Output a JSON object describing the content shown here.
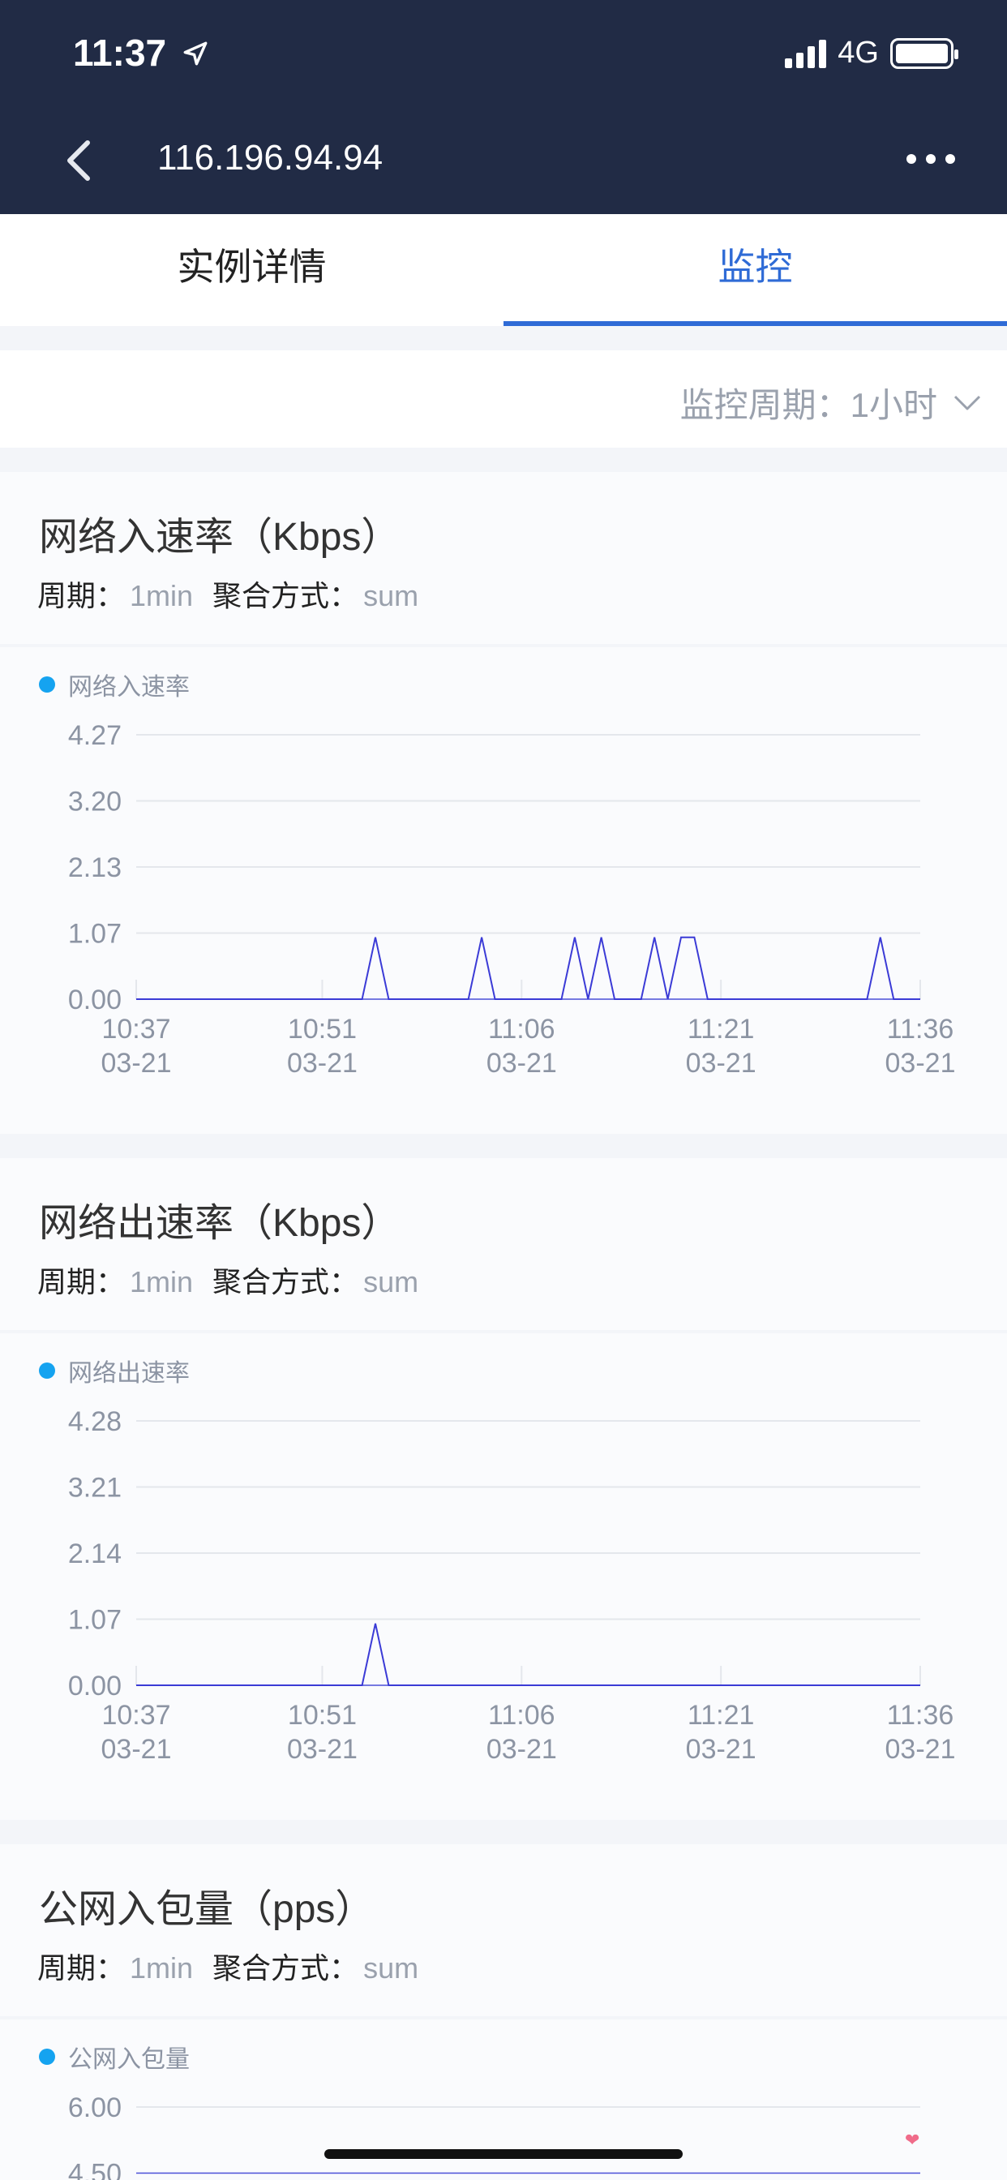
{
  "status": {
    "time": "11:37",
    "network": "4G"
  },
  "nav": {
    "title": "116.196.94.94"
  },
  "tabs": [
    {
      "label": "实例详情"
    },
    {
      "label": "监控"
    }
  ],
  "period": {
    "label": "监控周期：",
    "value": "1小时"
  },
  "meta_labels": {
    "period": "周期：",
    "aggregate": "聚合方式："
  },
  "colors": {
    "accent": "#2f6bd6",
    "line": "#3b3bd6",
    "legend": "#15a3f0",
    "header": "#212b45"
  },
  "cards": [
    {
      "title": "网络入速率（Kbps）",
      "period_value": "1min",
      "aggregate_value": "sum",
      "legend": "网络入速率",
      "chart_data": {
        "type": "line",
        "ylim": [
          0,
          4.27
        ],
        "yticks": [
          "4.27",
          "3.20",
          "2.13",
          "1.07",
          "0.00"
        ],
        "xticks": [
          {
            "time": "10:37",
            "date": "03-21"
          },
          {
            "time": "10:51",
            "date": "03-21"
          },
          {
            "time": "11:06",
            "date": "03-21"
          },
          {
            "time": "11:21",
            "date": "03-21"
          },
          {
            "time": "11:36",
            "date": "03-21"
          }
        ],
        "x_minutes": [
          "10:37",
          "10:38",
          "10:39",
          "10:40",
          "10:41",
          "10:42",
          "10:43",
          "10:44",
          "10:45",
          "10:46",
          "10:47",
          "10:48",
          "10:49",
          "10:50",
          "10:51",
          "10:52",
          "10:53",
          "10:54",
          "10:55",
          "10:56",
          "10:57",
          "10:58",
          "10:59",
          "11:00",
          "11:01",
          "11:02",
          "11:03",
          "11:04",
          "11:05",
          "11:06",
          "11:07",
          "11:08",
          "11:09",
          "11:10",
          "11:11",
          "11:12",
          "11:13",
          "11:14",
          "11:15",
          "11:16",
          "11:17",
          "11:18",
          "11:19",
          "11:20",
          "11:21",
          "11:22",
          "11:23",
          "11:24",
          "11:25",
          "11:26",
          "11:27",
          "11:28",
          "11:29",
          "11:30",
          "11:31",
          "11:32",
          "11:33",
          "11:34",
          "11:35",
          "11:36"
        ],
        "series": [
          {
            "name": "网络入速率",
            "values": [
              0,
              0,
              0,
              0,
              0,
              0,
              0,
              0,
              0,
              0,
              0,
              0,
              0,
              0,
              0,
              0,
              0,
              0,
              1,
              0,
              0,
              0,
              0,
              0,
              0,
              0,
              1,
              0,
              0,
              0,
              0,
              0,
              0,
              1,
              0,
              1,
              0,
              0,
              0,
              1,
              0,
              1,
              1,
              0,
              0,
              0,
              0,
              0,
              0,
              0,
              0,
              0,
              0,
              0,
              0,
              0,
              1,
              0,
              0,
              0
            ]
          }
        ]
      }
    },
    {
      "title": "网络出速率（Kbps）",
      "period_value": "1min",
      "aggregate_value": "sum",
      "legend": "网络出速率",
      "chart_data": {
        "type": "line",
        "ylim": [
          0,
          4.28
        ],
        "yticks": [
          "4.28",
          "3.21",
          "2.14",
          "1.07",
          "0.00"
        ],
        "xticks": [
          {
            "time": "10:37",
            "date": "03-21"
          },
          {
            "time": "10:51",
            "date": "03-21"
          },
          {
            "time": "11:06",
            "date": "03-21"
          },
          {
            "time": "11:21",
            "date": "03-21"
          },
          {
            "time": "11:36",
            "date": "03-21"
          }
        ],
        "x_minutes": [
          "10:37",
          "10:38",
          "10:39",
          "10:40",
          "10:41",
          "10:42",
          "10:43",
          "10:44",
          "10:45",
          "10:46",
          "10:47",
          "10:48",
          "10:49",
          "10:50",
          "10:51",
          "10:52",
          "10:53",
          "10:54",
          "10:55",
          "10:56",
          "10:57",
          "10:58",
          "10:59",
          "11:00",
          "11:01",
          "11:02",
          "11:03",
          "11:04",
          "11:05",
          "11:06",
          "11:07",
          "11:08",
          "11:09",
          "11:10",
          "11:11",
          "11:12",
          "11:13",
          "11:14",
          "11:15",
          "11:16",
          "11:17",
          "11:18",
          "11:19",
          "11:20",
          "11:21",
          "11:22",
          "11:23",
          "11:24",
          "11:25",
          "11:26",
          "11:27",
          "11:28",
          "11:29",
          "11:30",
          "11:31",
          "11:32",
          "11:33",
          "11:34",
          "11:35",
          "11:36"
        ],
        "series": [
          {
            "name": "网络出速率",
            "values": [
              0,
              0,
              0,
              0,
              0,
              0,
              0,
              0,
              0,
              0,
              0,
              0,
              0,
              0,
              0,
              0,
              0,
              0,
              1,
              0,
              0,
              0,
              0,
              0,
              0,
              0,
              0,
              0,
              0,
              0,
              0,
              0,
              0,
              0,
              0,
              0,
              0,
              0,
              0,
              0,
              0,
              0,
              0,
              0,
              0,
              0,
              0,
              0,
              0,
              0,
              0,
              0,
              0,
              0,
              0,
              0,
              0,
              0,
              0,
              0
            ]
          }
        ]
      }
    },
    {
      "title": "公网入包量（pps）",
      "period_value": "1min",
      "aggregate_value": "sum",
      "legend": "公网入包量",
      "chart_data": {
        "type": "line",
        "yticks": [
          "6.00",
          "4.50"
        ]
      }
    }
  ]
}
